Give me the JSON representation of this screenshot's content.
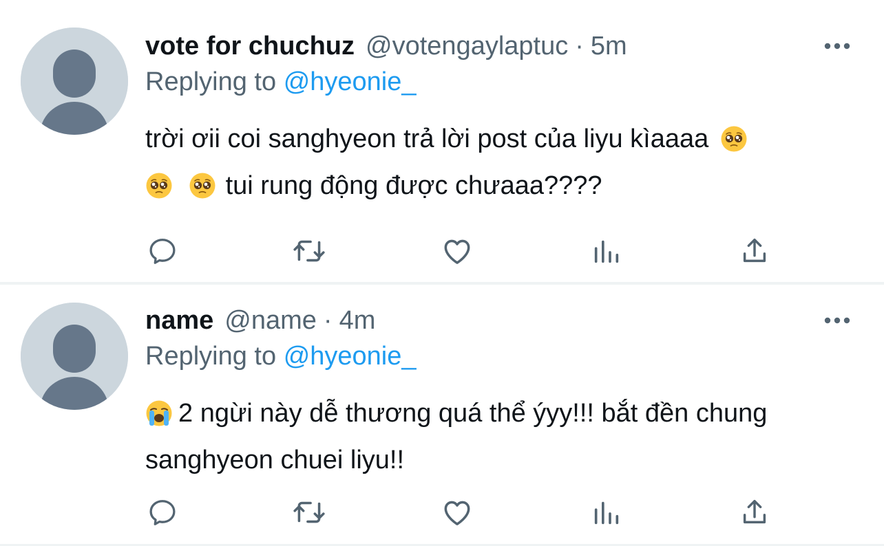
{
  "colors": {
    "text": "#0f1419",
    "secondary": "#536471",
    "accent": "#1d9bf0",
    "avatar_bg": "#ccd6dd",
    "avatar_fg": "#66778a",
    "divider": "#eff3f4"
  },
  "tweets": [
    {
      "display_name": "vote for chuchuz",
      "handle": "@votengaylaptuc",
      "separator": "·",
      "time": "5m",
      "replying_prefix": "Replying to",
      "replying_to": "@hyeonie_",
      "text_part1": "trời ơii coi sanghyeon trả lời post của liyu kìaaaa",
      "text_part2": "tui rung động được chưaaa????",
      "emoji_name": "pleading-face-emoji",
      "actions": [
        "reply-icon",
        "retweet-icon",
        "like-icon",
        "views-icon",
        "share-icon"
      ]
    },
    {
      "display_name": "name",
      "handle": "@name",
      "separator": "·",
      "time": "4m",
      "replying_prefix": "Replying to",
      "replying_to": "@hyeonie_",
      "text_part1": "2 ngừi này dễ thương quá thể ýyy!!! bắt đền chung sanghyeon chuei liyu!!",
      "emoji_name": "loudly-crying-face-emoji",
      "actions": [
        "reply-icon",
        "retweet-icon",
        "like-icon",
        "views-icon",
        "share-icon"
      ]
    }
  ]
}
